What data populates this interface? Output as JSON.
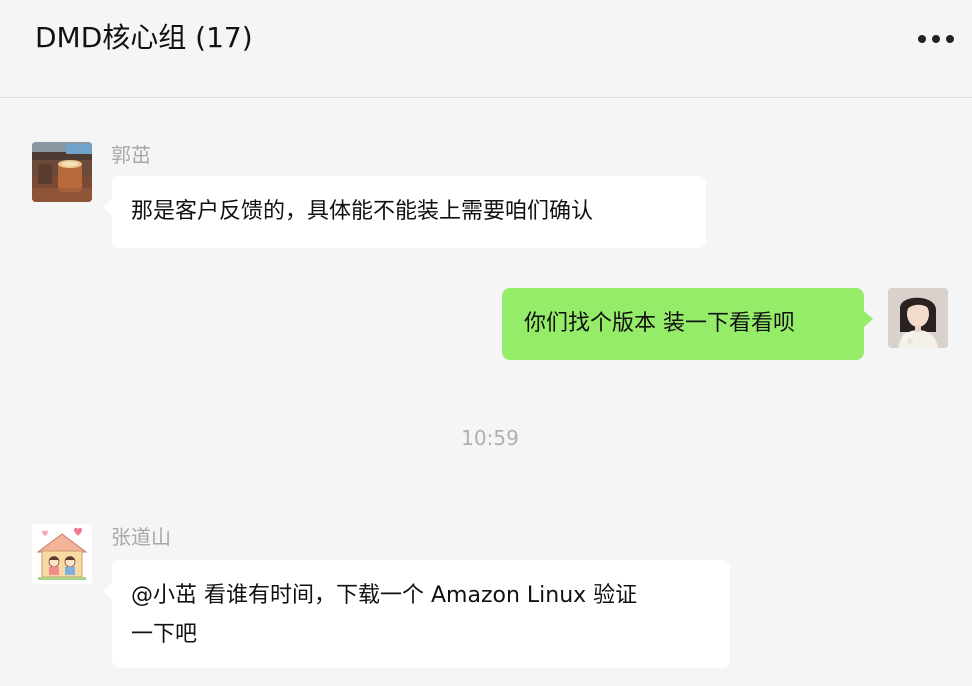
{
  "header": {
    "title": "DMD核心组 (17)",
    "more_icon": "more-dots-icon"
  },
  "messages": [
    {
      "direction": "incoming",
      "sender": "郭茁",
      "avatar": "avatar-coffee-photo",
      "text": "那是客户反馈的，具体能不能装上需要咱们确认"
    },
    {
      "direction": "outgoing",
      "avatar": "avatar-user-photo",
      "text": "你们找个版本 装一下看看呗"
    },
    {
      "direction": "incoming",
      "sender": "张道山",
      "avatar": "avatar-cartoon-house",
      "lines": [
        "@小茁 看谁有时间，下载一个 Amazon Linux 验证",
        "一下吧"
      ]
    }
  ],
  "timestamp": "10:59",
  "colors": {
    "background": "#f5f5f5",
    "incoming_bubble": "#ffffff",
    "outgoing_bubble": "#95ec69",
    "sender_text": "#a8a8a8",
    "timestamp_text": "#b0b0b0"
  }
}
